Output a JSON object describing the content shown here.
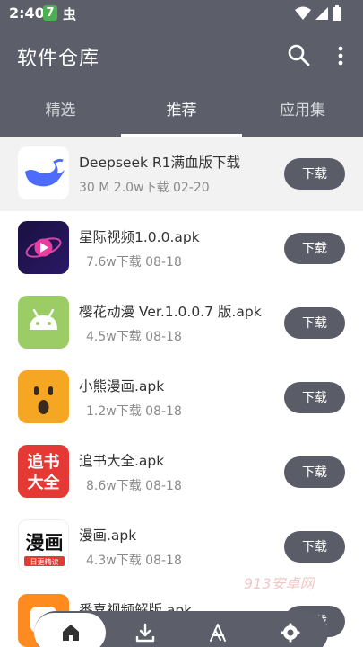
{
  "status": {
    "time": "2:40",
    "badge": "7",
    "bug": "虫"
  },
  "appbar": {
    "title": "软件仓库"
  },
  "tabs": [
    {
      "label": "精选"
    },
    {
      "label": "推荐"
    },
    {
      "label": "应用集"
    }
  ],
  "apps": [
    {
      "name": "Deepseek R1满血版下载",
      "meta": "30 M  2.0w下载  02-20",
      "button": "下载"
    },
    {
      "name": "星际视频1.0.0.apk",
      "meta": "7.6w下载  08-18",
      "button": "下载"
    },
    {
      "name": "樱花动漫 Ver.1.0.0.7 版.apk",
      "meta": "4.5w下载  08-18",
      "button": "下载"
    },
    {
      "name": "小熊漫画.apk",
      "meta": "1.2w下载  08-18",
      "button": "下载"
    },
    {
      "name": "追书大全.apk",
      "meta": "8.6w下载  08-18",
      "button": "下载"
    },
    {
      "name": "漫画.apk",
      "meta": "4.3w下载  08-18",
      "button": "下载"
    },
    {
      "name": "番喜视频解版.apk",
      "meta": "",
      "button": "下载"
    }
  ],
  "icon_text": {
    "zhuishu_1": "追书",
    "zhuishu_2": "大全",
    "manhua_1": "漫画",
    "manhua_2": "日更精读"
  },
  "watermark": "913安卓网"
}
